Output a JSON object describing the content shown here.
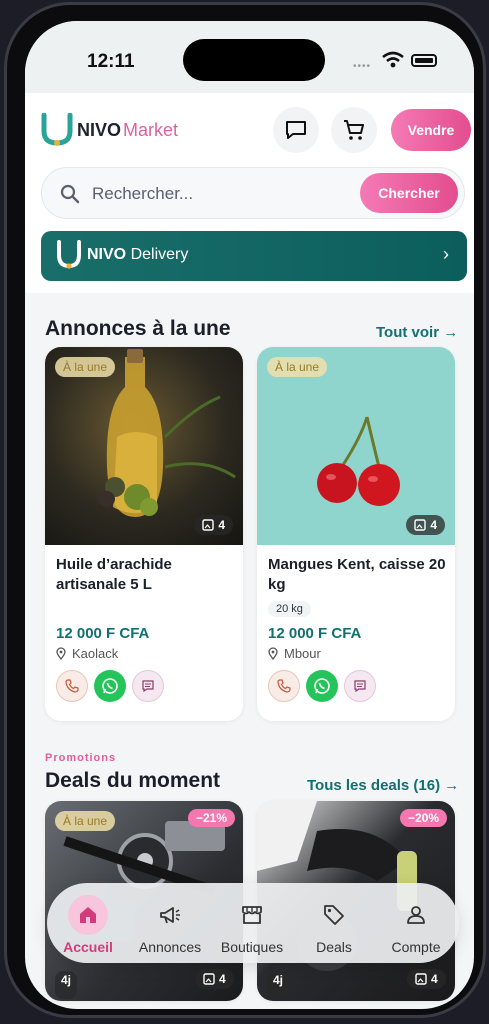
{
  "status_bar": {
    "time": "12:11"
  },
  "header": {
    "logo_nivo": "NIVO",
    "logo_market": "Market",
    "sell_label": "Vendre"
  },
  "search": {
    "placeholder": "Rechercher...",
    "button_label": "Chercher"
  },
  "delivery_banner": {
    "brand": "NIVO",
    "label": "Delivery"
  },
  "featured": {
    "title": "Annonces à la une",
    "see_all": "Tout voir →",
    "cards": [
      {
        "badge": "À la une",
        "photos": "4",
        "title": "Huile d’arachide artisanale 5 L",
        "chip": "",
        "price": "12 000 F CFA",
        "location": "Kaolack"
      },
      {
        "badge": "À la une",
        "photos": "4",
        "title": "Mangues Kent, caisse 20 kg",
        "chip": "20 kg",
        "price": "12 000 F CFA",
        "location": "Mbour"
      }
    ]
  },
  "deals": {
    "label": "Promotions",
    "title": "Deals du moment",
    "see_all": "Tous les deals (16) →",
    "cards": [
      {
        "badge": "À la une",
        "discount": "−21%",
        "age": "4j",
        "photos": "4"
      },
      {
        "discount": "−20%",
        "age": "4j",
        "photos": "4"
      }
    ]
  },
  "tabbar": {
    "items": [
      {
        "label": "Accueil",
        "icon": "home-icon",
        "active": true
      },
      {
        "label": "Annonces",
        "icon": "megaphone-icon"
      },
      {
        "label": "Boutiques",
        "icon": "store-icon"
      },
      {
        "label": "Deals",
        "icon": "tag-icon"
      },
      {
        "label": "Compte",
        "icon": "user-icon"
      }
    ]
  },
  "colors": {
    "brand_teal": "#137070",
    "brand_pink": "#e34d8e",
    "whatsapp": "#25c45a"
  }
}
